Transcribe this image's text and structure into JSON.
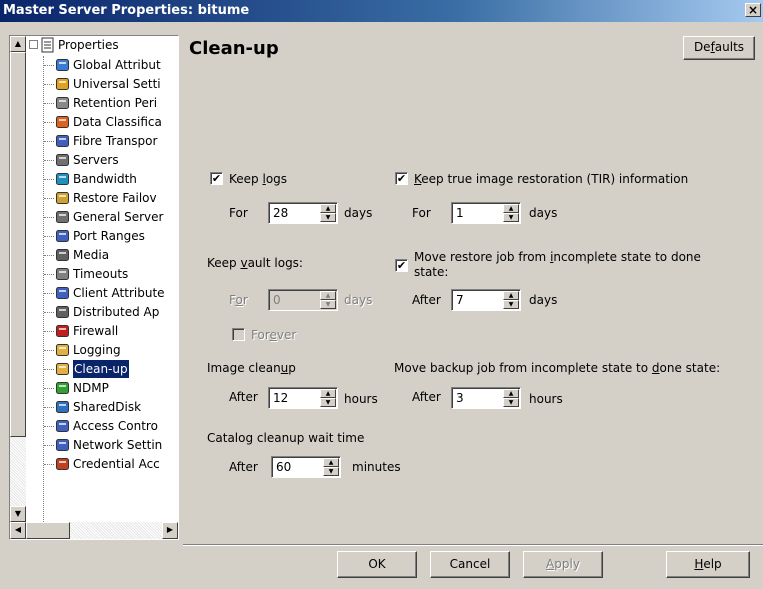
{
  "window": {
    "title": "Master Server Properties: bitume",
    "close_label": "×"
  },
  "tree": {
    "root_label": "Properties",
    "items": [
      {
        "label": "Global Attribut",
        "icon": "globe-icon",
        "color": "#3a7bd5"
      },
      {
        "label": "Universal Setti",
        "icon": "settings-icon",
        "color": "#e0a020"
      },
      {
        "label": "Retention Peri",
        "icon": "clock-icon",
        "color": "#888888"
      },
      {
        "label": "Data Classifica",
        "icon": "classification-icon",
        "color": "#e06020"
      },
      {
        "label": "Fibre Transpor",
        "icon": "monitor-icon",
        "color": "#4060c0"
      },
      {
        "label": "Servers",
        "icon": "server-icon",
        "color": "#707070"
      },
      {
        "label": "Bandwidth",
        "icon": "bandwidth-icon",
        "color": "#2090c0"
      },
      {
        "label": "Restore Failov",
        "icon": "restore-icon",
        "color": "#d0a030"
      },
      {
        "label": "General Server",
        "icon": "server-icon",
        "color": "#707070"
      },
      {
        "label": "Port Ranges",
        "icon": "port-icon",
        "color": "#4060c0"
      },
      {
        "label": "Media",
        "icon": "media-icon",
        "color": "#606060"
      },
      {
        "label": "Timeouts",
        "icon": "timeout-icon",
        "color": "#808080"
      },
      {
        "label": "Client Attribute",
        "icon": "client-icon",
        "color": "#4060c0"
      },
      {
        "label": "Distributed Ap",
        "icon": "distributed-icon",
        "color": "#606060"
      },
      {
        "label": "Firewall",
        "icon": "firewall-icon",
        "color": "#c02020"
      },
      {
        "label": "Logging",
        "icon": "logging-icon",
        "color": "#e0b040"
      },
      {
        "label": "Clean-up",
        "icon": "cleanup-icon",
        "color": "#e0b040",
        "selected": true
      },
      {
        "label": "NDMP",
        "icon": "ndmp-icon",
        "color": "#30a030"
      },
      {
        "label": "SharedDisk",
        "icon": "shared-disk-icon",
        "color": "#3070c0"
      },
      {
        "label": "Access Contro",
        "icon": "access-control-icon",
        "color": "#4060c0"
      },
      {
        "label": "Network Settin",
        "icon": "network-icon",
        "color": "#4060c0"
      },
      {
        "label": "Credential Acc",
        "icon": "credential-icon",
        "color": "#c04020"
      }
    ]
  },
  "panel": {
    "title": "Clean-up",
    "defaults_button": {
      "pre": "De",
      "key": "f",
      "post": "aults"
    },
    "keep_logs": {
      "checked": "✔",
      "pre": "Keep ",
      "key": "l",
      "post": "ogs",
      "for_label": "For",
      "value": "28",
      "unit": "days"
    },
    "keep_tir": {
      "checked": "✔",
      "pre": "",
      "key": "K",
      "post": "eep true image restoration (TIR) information",
      "for_label": "For",
      "value": "1",
      "unit": "days"
    },
    "keep_vault": {
      "pre": "Keep ",
      "key": "v",
      "post": "ault logs:",
      "for_pre": "F",
      "for_key": "o",
      "for_post": "r",
      "value": "0",
      "unit": "days",
      "forever_pre": "For",
      "forever_key": "e",
      "forever_post": "ver"
    },
    "move_restore": {
      "checked": "✔",
      "line1_pre": "Move restore job from ",
      "line1_key": "i",
      "line1_post": "ncomplete state to done",
      "line2": "state:",
      "after_label": "After",
      "value": "7",
      "unit": "days"
    },
    "image_cleanup": {
      "pre": "Image clean",
      "key": "u",
      "post": "p",
      "after_label": "After",
      "value": "12",
      "unit": "hours"
    },
    "move_backup": {
      "pre": "Move backup job from incomplete state to ",
      "key": "d",
      "post": "one state:",
      "after_label": "After",
      "value": "3",
      "unit": "hours"
    },
    "catalog_cleanup": {
      "label": "Catalog cleanup wait time",
      "after_label": "After",
      "value": "60",
      "unit": "minutes"
    }
  },
  "buttons": {
    "ok": "OK",
    "cancel": "Cancel",
    "apply_pre": "",
    "apply_key": "A",
    "apply_post": "pply",
    "help_pre": "",
    "help_key": "H",
    "help_post": "elp"
  }
}
